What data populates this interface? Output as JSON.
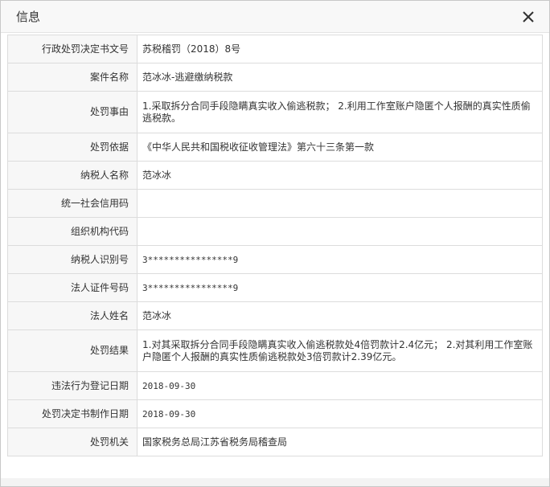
{
  "dialog": {
    "title": "信息",
    "close_icon": "close-icon"
  },
  "rows": [
    {
      "label": "行政处罚决定书文号",
      "value": "苏税稽罚（2018）8号"
    },
    {
      "label": "案件名称",
      "value": "范冰冰-逃避缴纳税款"
    },
    {
      "label": "处罚事由",
      "value": "1.采取拆分合同手段隐瞒真实收入偷逃税款； 2.利用工作室账户隐匿个人报酬的真实性质偷逃税款。"
    },
    {
      "label": "处罚依据",
      "value": "《中华人民共和国税收征收管理法》第六十三条第一款"
    },
    {
      "label": "纳税人名称",
      "value": "范冰冰"
    },
    {
      "label": "统一社会信用码",
      "value": ""
    },
    {
      "label": "组织机构代码",
      "value": ""
    },
    {
      "label": "纳税人识别号",
      "value": "3****************9"
    },
    {
      "label": "法人证件号码",
      "value": "3****************9"
    },
    {
      "label": "法人姓名",
      "value": "范冰冰"
    },
    {
      "label": "处罚结果",
      "value": "1.对其采取拆分合同手段隐瞒真实收入偷逃税款处4倍罚款计2.4亿元； 2.对其利用工作室账户隐匿个人报酬的真实性质偷逃税款处3倍罚款计2.39亿元。"
    },
    {
      "label": "违法行为登记日期",
      "value": "2018-09-30"
    },
    {
      "label": "处罚决定书制作日期",
      "value": "2018-09-30"
    },
    {
      "label": "处罚机关",
      "value": "国家税务总局江苏省税务局稽查局"
    }
  ]
}
